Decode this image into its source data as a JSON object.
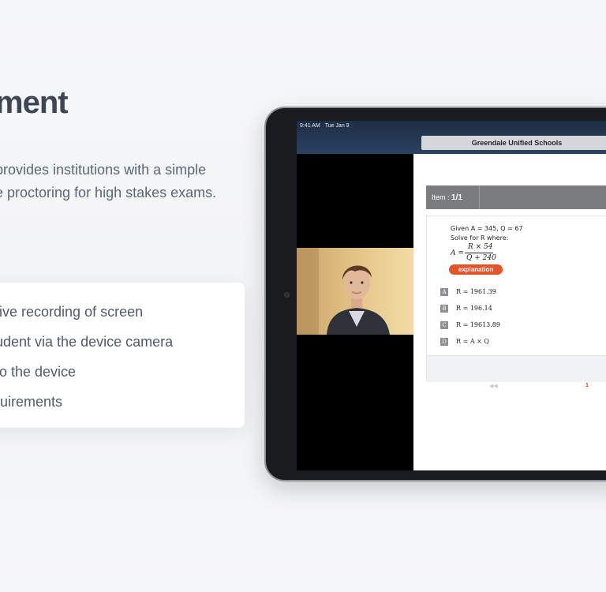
{
  "heading": "ment",
  "intro": {
    "line1": "provides institutions with a simple",
    "line2": "e proctoring for high stakes exams."
  },
  "features": [
    "e live recording of screen",
    " student via the device camera",
    "ts o the device",
    "equirements"
  ],
  "device": {
    "status_time": "9:41 AM",
    "status_date": "Tue Jan 9",
    "school_name": "Greendale Unified Schools",
    "item_label": "Item :",
    "item_value": "1/1",
    "question_line1": "Given A = 345, Q = 67",
    "question_line2": "Solve for R where:",
    "formula": {
      "lhs": "A =",
      "numerator": "R × 54",
      "denominator": "Q + 240"
    },
    "explanation_label": "explanation",
    "options": [
      {
        "letter": "A",
        "text": "R = 1961.39"
      },
      {
        "letter": "B",
        "text": "R = 196.14"
      },
      {
        "letter": "C",
        "text": "R = 19613.89"
      },
      {
        "letter": "D",
        "text": "R = A × Q"
      }
    ],
    "pager": {
      "prev_icon": "◀◀",
      "page": "1"
    }
  },
  "colors": {
    "accent": "#e4532a",
    "status_bar": "#2a4262",
    "heading": "#3d4654"
  }
}
